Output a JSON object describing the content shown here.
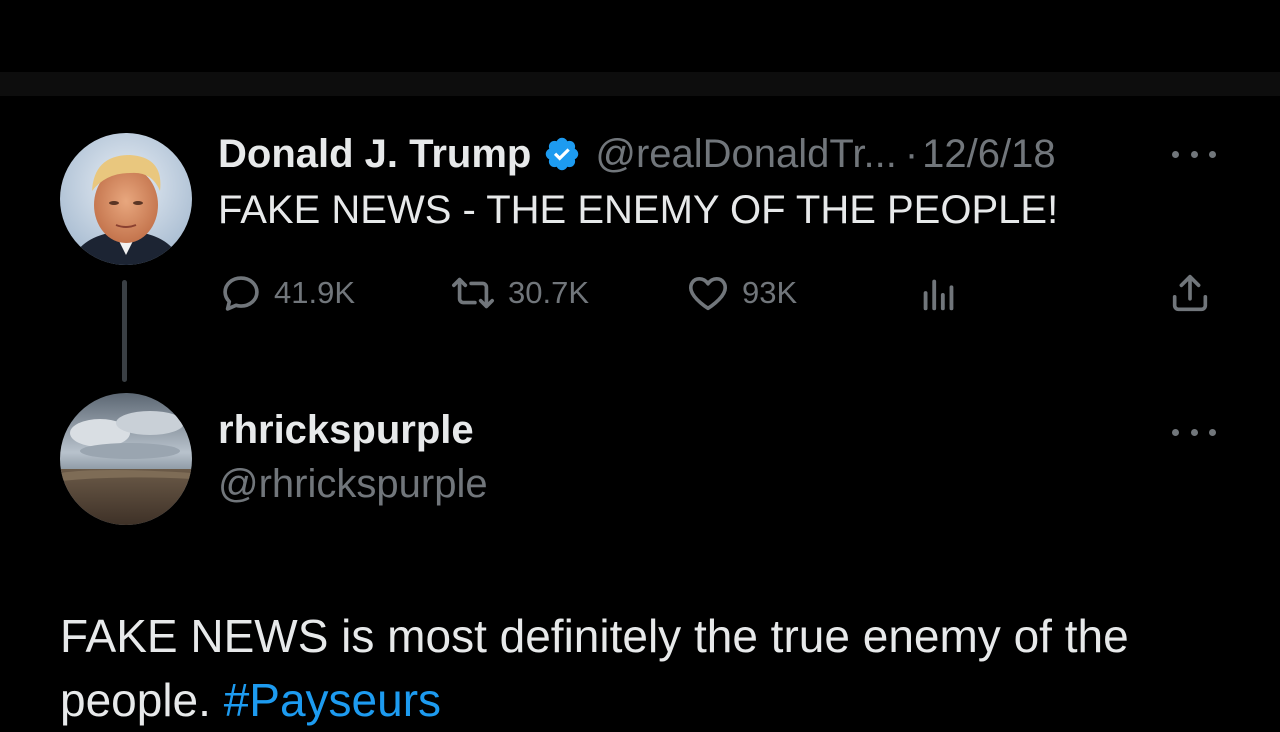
{
  "tweet": {
    "display_name": "Donald J. Trump",
    "verified_icon": "verified-badge-icon",
    "verified_color": "#1d9bf0",
    "handle": "@realDonaldTr...",
    "separator": "·",
    "date": "12/6/18",
    "text": "FAKE NEWS - THE ENEMY OF THE PEOPLE!",
    "actions": {
      "reply_icon": "reply-icon",
      "reply_count": "41.9K",
      "retweet_icon": "retweet-icon",
      "retweet_count": "30.7K",
      "like_icon": "heart-icon",
      "like_count": "93K",
      "views_icon": "views-chart-icon",
      "share_icon": "share-icon"
    }
  },
  "reply": {
    "display_name": "rhrickspurple",
    "handle": "@rhrickspurple",
    "text_before": "FAKE NEWS is most definitely the true enemy of the people.",
    "hashtag": "#Payseurs"
  },
  "colors": {
    "background": "#000000",
    "text_primary": "#e7e9ea",
    "text_secondary": "#71767b",
    "accent": "#1d9bf0"
  }
}
